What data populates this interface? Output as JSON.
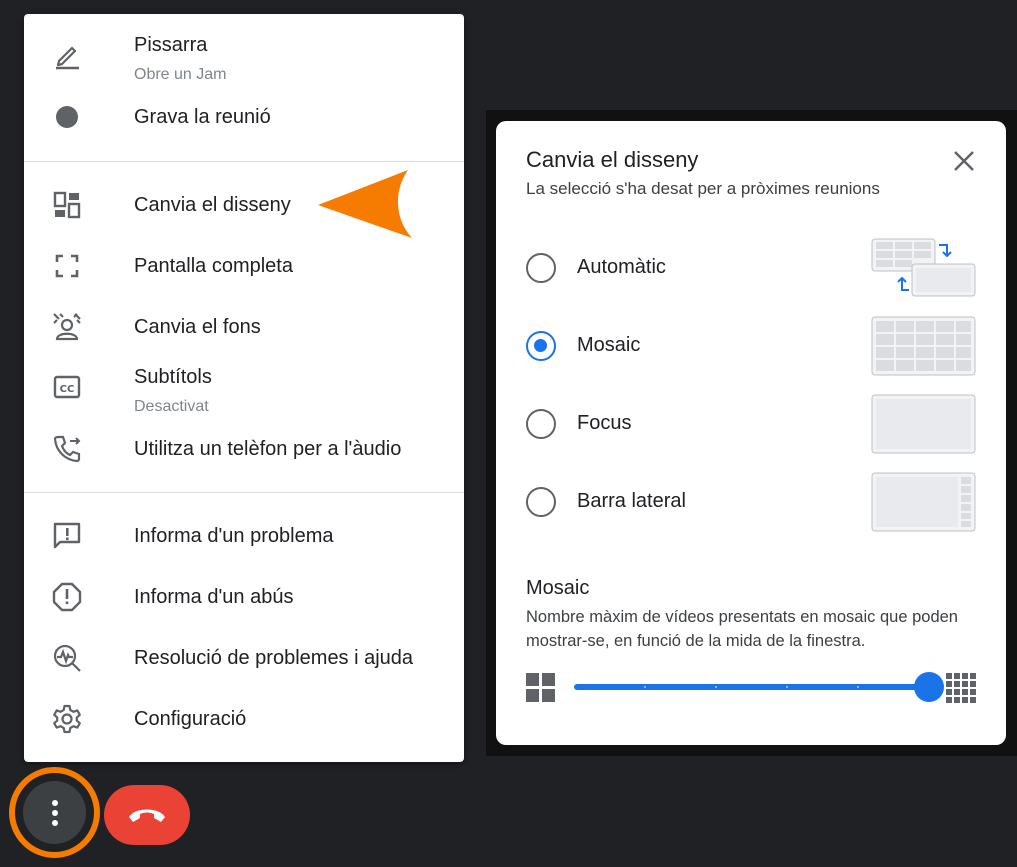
{
  "menu": {
    "items": [
      {
        "label": "Pissarra",
        "sub": "Obre un Jam",
        "icon": "pen-icon"
      },
      {
        "label": "Grava la reunió",
        "icon": "record-icon"
      },
      {
        "label": "Canvia el disseny",
        "icon": "layout-icon"
      },
      {
        "label": "Pantalla completa",
        "icon": "fullscreen-icon"
      },
      {
        "label": "Canvia el fons",
        "icon": "background-icon"
      },
      {
        "label": "Subtítols",
        "sub": "Desactivat",
        "icon": "captions-icon"
      },
      {
        "label": "Utilitza un telèfon per a l'àudio",
        "icon": "phone-forward-icon"
      },
      {
        "label": "Informa d'un problema",
        "icon": "feedback-icon"
      },
      {
        "label": "Informa d'un abús",
        "icon": "report-icon"
      },
      {
        "label": "Resolució de problemes i ajuda",
        "icon": "troubleshoot-icon"
      },
      {
        "label": "Configuració",
        "icon": "gear-icon"
      }
    ]
  },
  "dialog": {
    "title": "Canvia el disseny",
    "subtitle": "La selecció s'ha desat per a pròximes reunions",
    "options": [
      {
        "label": "Automàtic",
        "selected": false
      },
      {
        "label": "Mosaic",
        "selected": true
      },
      {
        "label": "Focus",
        "selected": false
      },
      {
        "label": "Barra lateral",
        "selected": false
      }
    ],
    "section_title": "Mosaic",
    "section_desc": "Nombre màxim de vídeos presentats en mosaic que poden mostrar-se, en funció de la mida de la finestra.",
    "slider_value": 1.0
  },
  "colors": {
    "accent": "#1a73e8",
    "highlight": "#f57c00",
    "end_call": "#ea4335"
  }
}
